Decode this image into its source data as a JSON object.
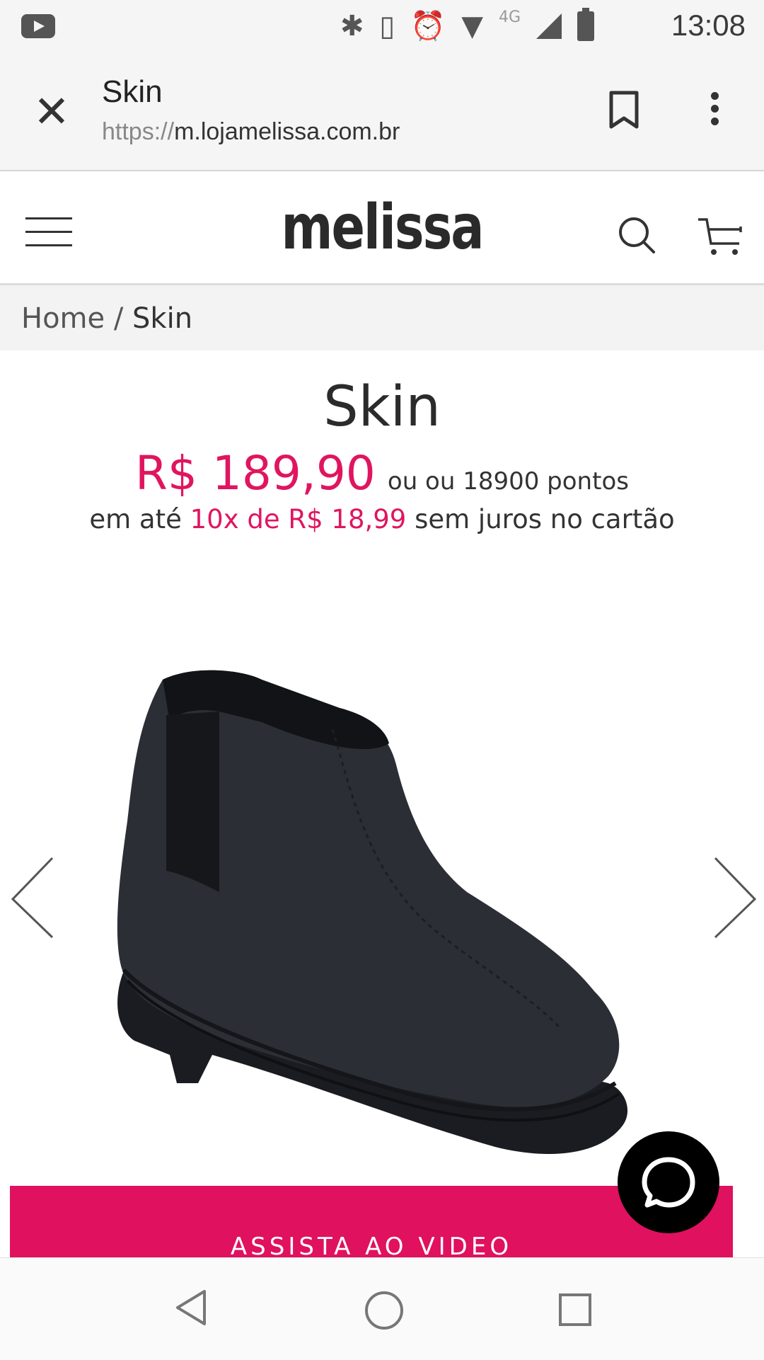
{
  "status_bar": {
    "time": "13:08",
    "network": "4G",
    "icons": [
      "youtube-icon",
      "bluetooth-icon",
      "vibrate-icon",
      "alarm-icon",
      "wifi-icon",
      "signal-icon",
      "battery-icon"
    ]
  },
  "custom_tab": {
    "title": "Skin",
    "url_scheme": "https://",
    "url_host": "m.lojamelissa.com.br"
  },
  "site": {
    "logo": "melissa"
  },
  "breadcrumb": {
    "home": "Home",
    "separator": " / ",
    "current": "Skin"
  },
  "product": {
    "title": "Skin",
    "price": "R$ 189,90",
    "points": "ou ou 18900 pontos",
    "installment_prefix": "em até ",
    "installment_highlight": "10x de R$ 18,99",
    "installment_suffix": " sem juros no cartão"
  },
  "video_button": {
    "label": "ASSISTA AO VIDEO"
  },
  "colors": {
    "accent": "#e0155f",
    "button": "#e0115e"
  }
}
